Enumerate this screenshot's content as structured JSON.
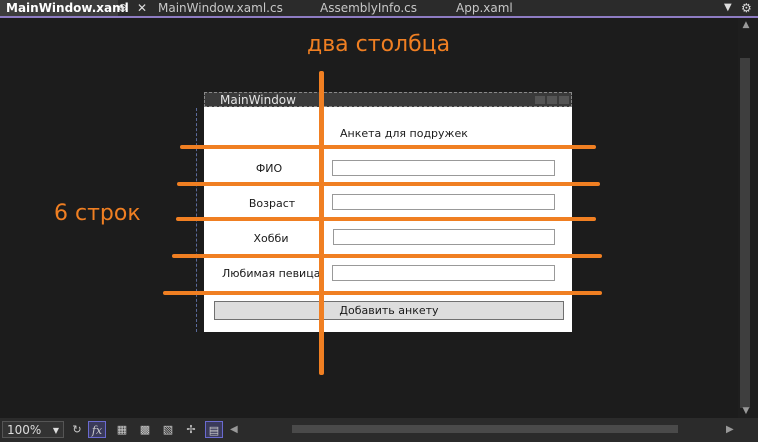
{
  "tabs": [
    {
      "label": "MainWindow.xaml",
      "active": true
    },
    {
      "label": "MainWindow.xaml.cs",
      "active": false
    },
    {
      "label": "AssemblyInfo.cs",
      "active": false
    },
    {
      "label": "App.xaml",
      "active": false
    }
  ],
  "tab_pin_glyph": "⊕",
  "tab_close_glyph": "✕",
  "accent_color": "#8e7cc3",
  "annotation_color": "#f07f22",
  "preview_window": {
    "title": "MainWindow",
    "header": "Анкета для подружек",
    "rows": [
      {
        "label": "ФИО",
        "value": ""
      },
      {
        "label": "Возраст",
        "value": ""
      },
      {
        "label": "Хобби",
        "value": ""
      },
      {
        "label": "Любимая певица",
        "value": ""
      }
    ],
    "button_label": "Добавить анкету"
  },
  "annotations": {
    "columns_label": "два столбца",
    "rows_label": "6 строк"
  },
  "bottom_toolbar": {
    "zoom": "100%",
    "fx_label": "fx"
  },
  "icons": [
    "pin-icon",
    "close-icon",
    "overflow-arrow-icon",
    "settings-gear-icon",
    "refresh-icon",
    "fx-icon",
    "grid-icon",
    "snap-grid-icon",
    "checker-icon",
    "snap-lines-icon",
    "xaml-doc-icon"
  ]
}
